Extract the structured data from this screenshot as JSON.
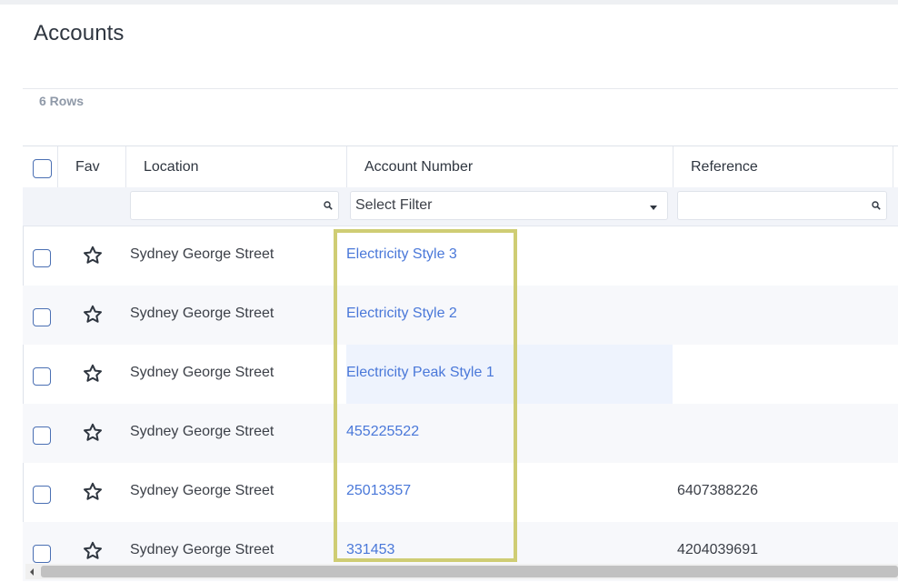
{
  "page": {
    "title": "Accounts",
    "row_count": "6 Rows"
  },
  "table": {
    "columns": {
      "fav": "Fav",
      "location": "Location",
      "account_number": "Account Number",
      "reference": "Reference"
    },
    "filters": {
      "account_number_placeholder": "Select Filter"
    },
    "rows": [
      {
        "location": "Sydney George Street",
        "account_number": "Electricity Style 3",
        "reference": ""
      },
      {
        "location": "Sydney George Street",
        "account_number": "Electricity Style 2",
        "reference": ""
      },
      {
        "location": "Sydney George Street",
        "account_number": "Electricity Peak Style 1",
        "reference": ""
      },
      {
        "location": "Sydney George Street",
        "account_number": "455225522",
        "reference": ""
      },
      {
        "location": "Sydney George Street",
        "account_number": "25013357",
        "reference": "6407388226"
      },
      {
        "location": "Sydney George Street",
        "account_number": "331453",
        "reference": "4204039691"
      }
    ]
  },
  "icons": {
    "favorite": "star-outline-icon",
    "filter_search": "magnifier-icon",
    "filter_dropdown": "caret-down-icon",
    "scroll_left": "arrow-left-icon"
  },
  "colors": {
    "link": "#4a78d9",
    "checkbox_border": "#4a6fb3",
    "annotation": "#cfcd74"
  }
}
